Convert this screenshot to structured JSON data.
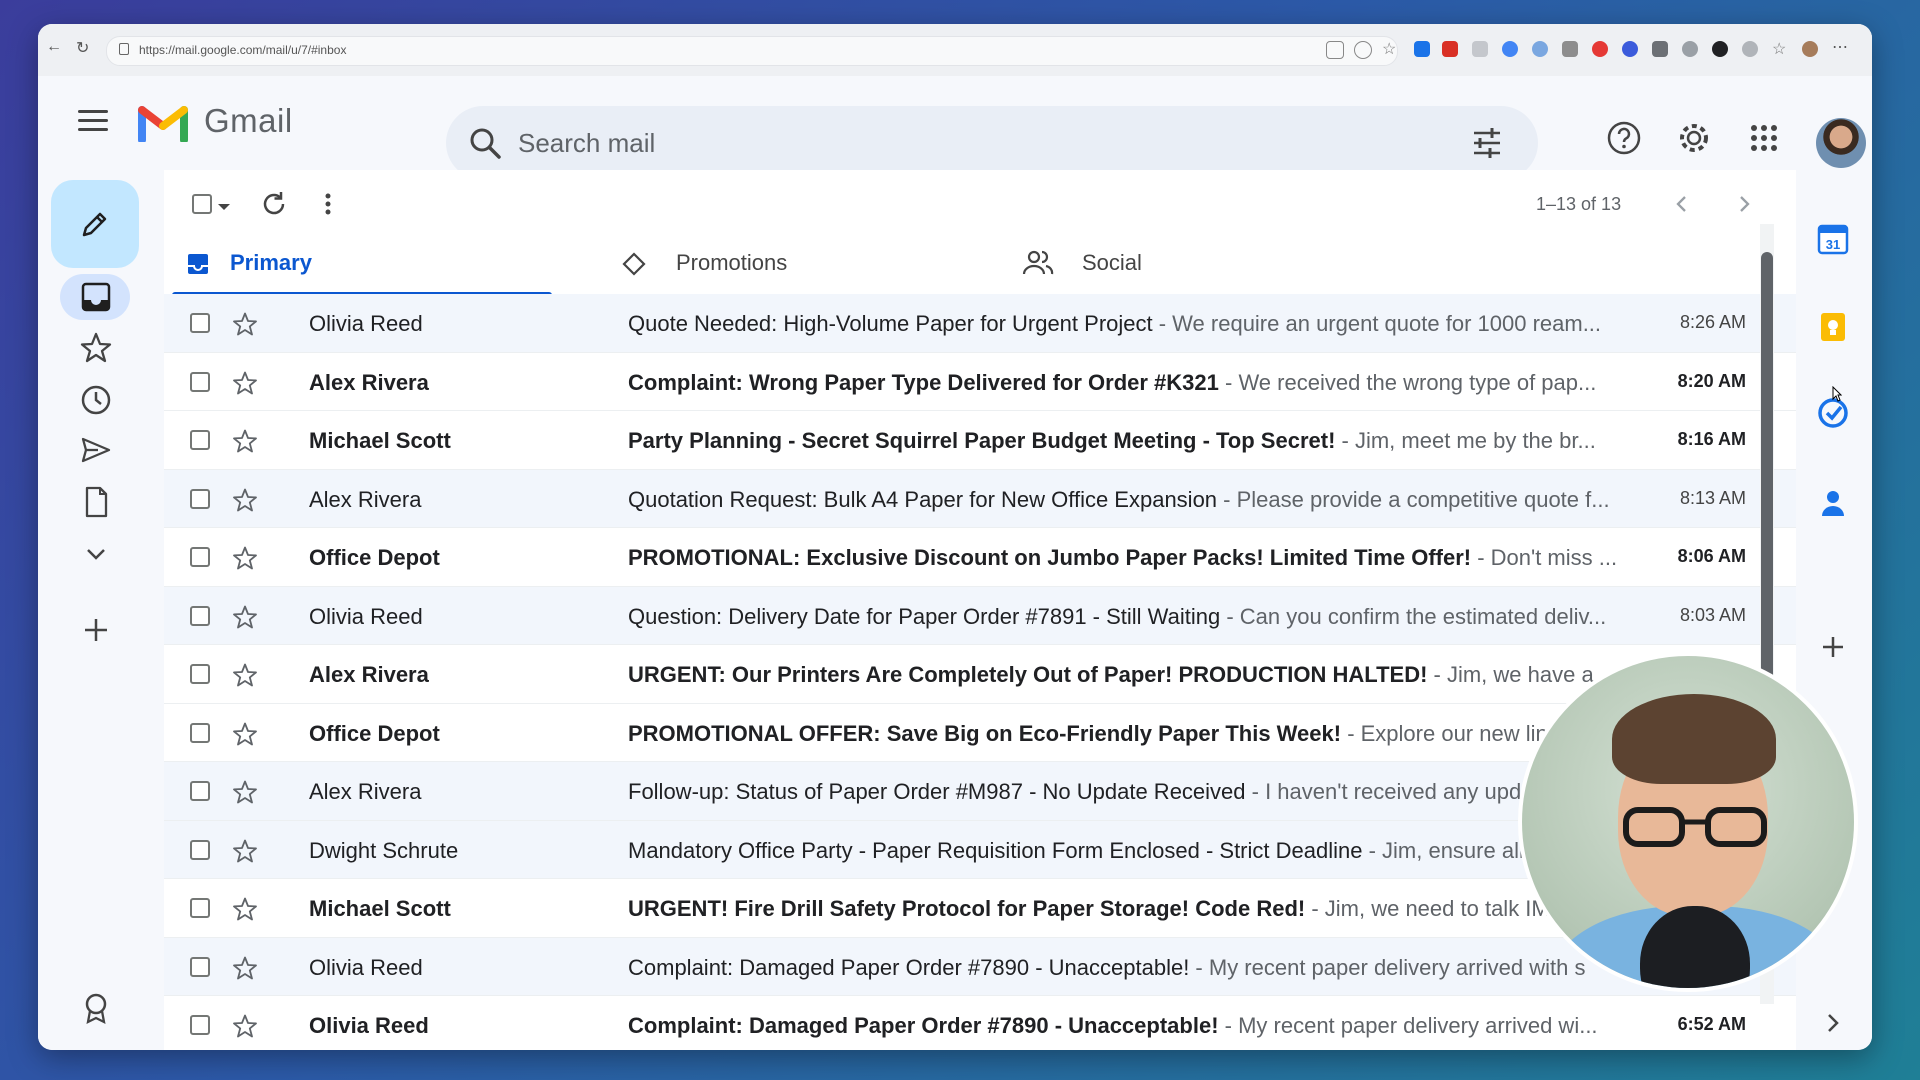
{
  "browser": {
    "url": "https://mail.google.com/mail/u/7/#inbox"
  },
  "header": {
    "app_name": "Gmail",
    "search_placeholder": "Search mail"
  },
  "toolbar": {
    "pagination": "1–13 of 13"
  },
  "tabs": [
    {
      "label": "Primary",
      "active": true
    },
    {
      "label": "Promotions",
      "active": false
    },
    {
      "label": "Social",
      "active": false
    }
  ],
  "emails": [
    {
      "sender": "Olivia Reed",
      "subject": "Quote Needed: High-Volume Paper for Urgent Project",
      "snippet": " - We require an urgent quote for 1000 ream...",
      "time": "8:26 AM",
      "unread": false
    },
    {
      "sender": "Alex Rivera",
      "subject": "Complaint: Wrong Paper Type Delivered for Order #K321",
      "snippet": " - We received the wrong type of pap...",
      "time": "8:20 AM",
      "unread": true
    },
    {
      "sender": "Michael Scott",
      "subject": "Party Planning - Secret Squirrel Paper Budget Meeting - Top Secret!",
      "snippet": " - Jim, meet me by the br...",
      "time": "8:16 AM",
      "unread": true
    },
    {
      "sender": "Alex Rivera",
      "subject": "Quotation Request: Bulk A4 Paper for New Office Expansion",
      "snippet": " - Please provide a competitive quote f...",
      "time": "8:13 AM",
      "unread": false
    },
    {
      "sender": "Office Depot",
      "subject": "PROMOTIONAL: Exclusive Discount on Jumbo Paper Packs! Limited Time Offer!",
      "snippet": " - Don't miss ...",
      "time": "8:06 AM",
      "unread": true
    },
    {
      "sender": "Olivia Reed",
      "subject": "Question: Delivery Date for Paper Order #7891 - Still Waiting",
      "snippet": " - Can you confirm the estimated deliv...",
      "time": "8:03 AM",
      "unread": false
    },
    {
      "sender": "Alex Rivera",
      "subject": "URGENT: Our Printers Are Completely Out of Paper! PRODUCTION HALTED!",
      "snippet": " - Jim, we have a...",
      "time": "",
      "unread": true
    },
    {
      "sender": "Office Depot",
      "subject": "PROMOTIONAL OFFER: Save Big on Eco-Friendly Paper This Week!",
      "snippet": " - Explore our new line",
      "time": "",
      "unread": true
    },
    {
      "sender": "Alex Rivera",
      "subject": "Follow-up: Status of Paper Order #M987 - No Update Received",
      "snippet": " - I haven't received any upda",
      "time": "",
      "unread": false
    },
    {
      "sender": "Dwight Schrute",
      "subject": "Mandatory Office Party - Paper Requisition Form Enclosed - Strict Deadline",
      "snippet": " - Jim, ensure all",
      "time": "",
      "unread": false
    },
    {
      "sender": "Michael Scott",
      "subject": "URGENT! Fire Drill Safety Protocol for Paper Storage! Code Red!",
      "snippet": " - Jim, we need to talk IM",
      "time": "",
      "unread": true
    },
    {
      "sender": "Olivia Reed",
      "subject": "Complaint: Damaged Paper Order #7890 - Unacceptable!",
      "snippet": " - My recent paper delivery arrived with s",
      "time": "",
      "unread": false
    },
    {
      "sender": "Olivia Reed",
      "subject": "Complaint: Damaged Paper Order #7890 - Unacceptable!",
      "snippet": " - My recent paper delivery arrived wi...",
      "time": "6:52 AM",
      "unread": true
    }
  ],
  "right_rail": {
    "calendar_day": "31"
  },
  "colors": {
    "accent": "#0b57d0",
    "compose_bg": "#c2e7ff",
    "read_row_bg": "#f2f6fc"
  }
}
